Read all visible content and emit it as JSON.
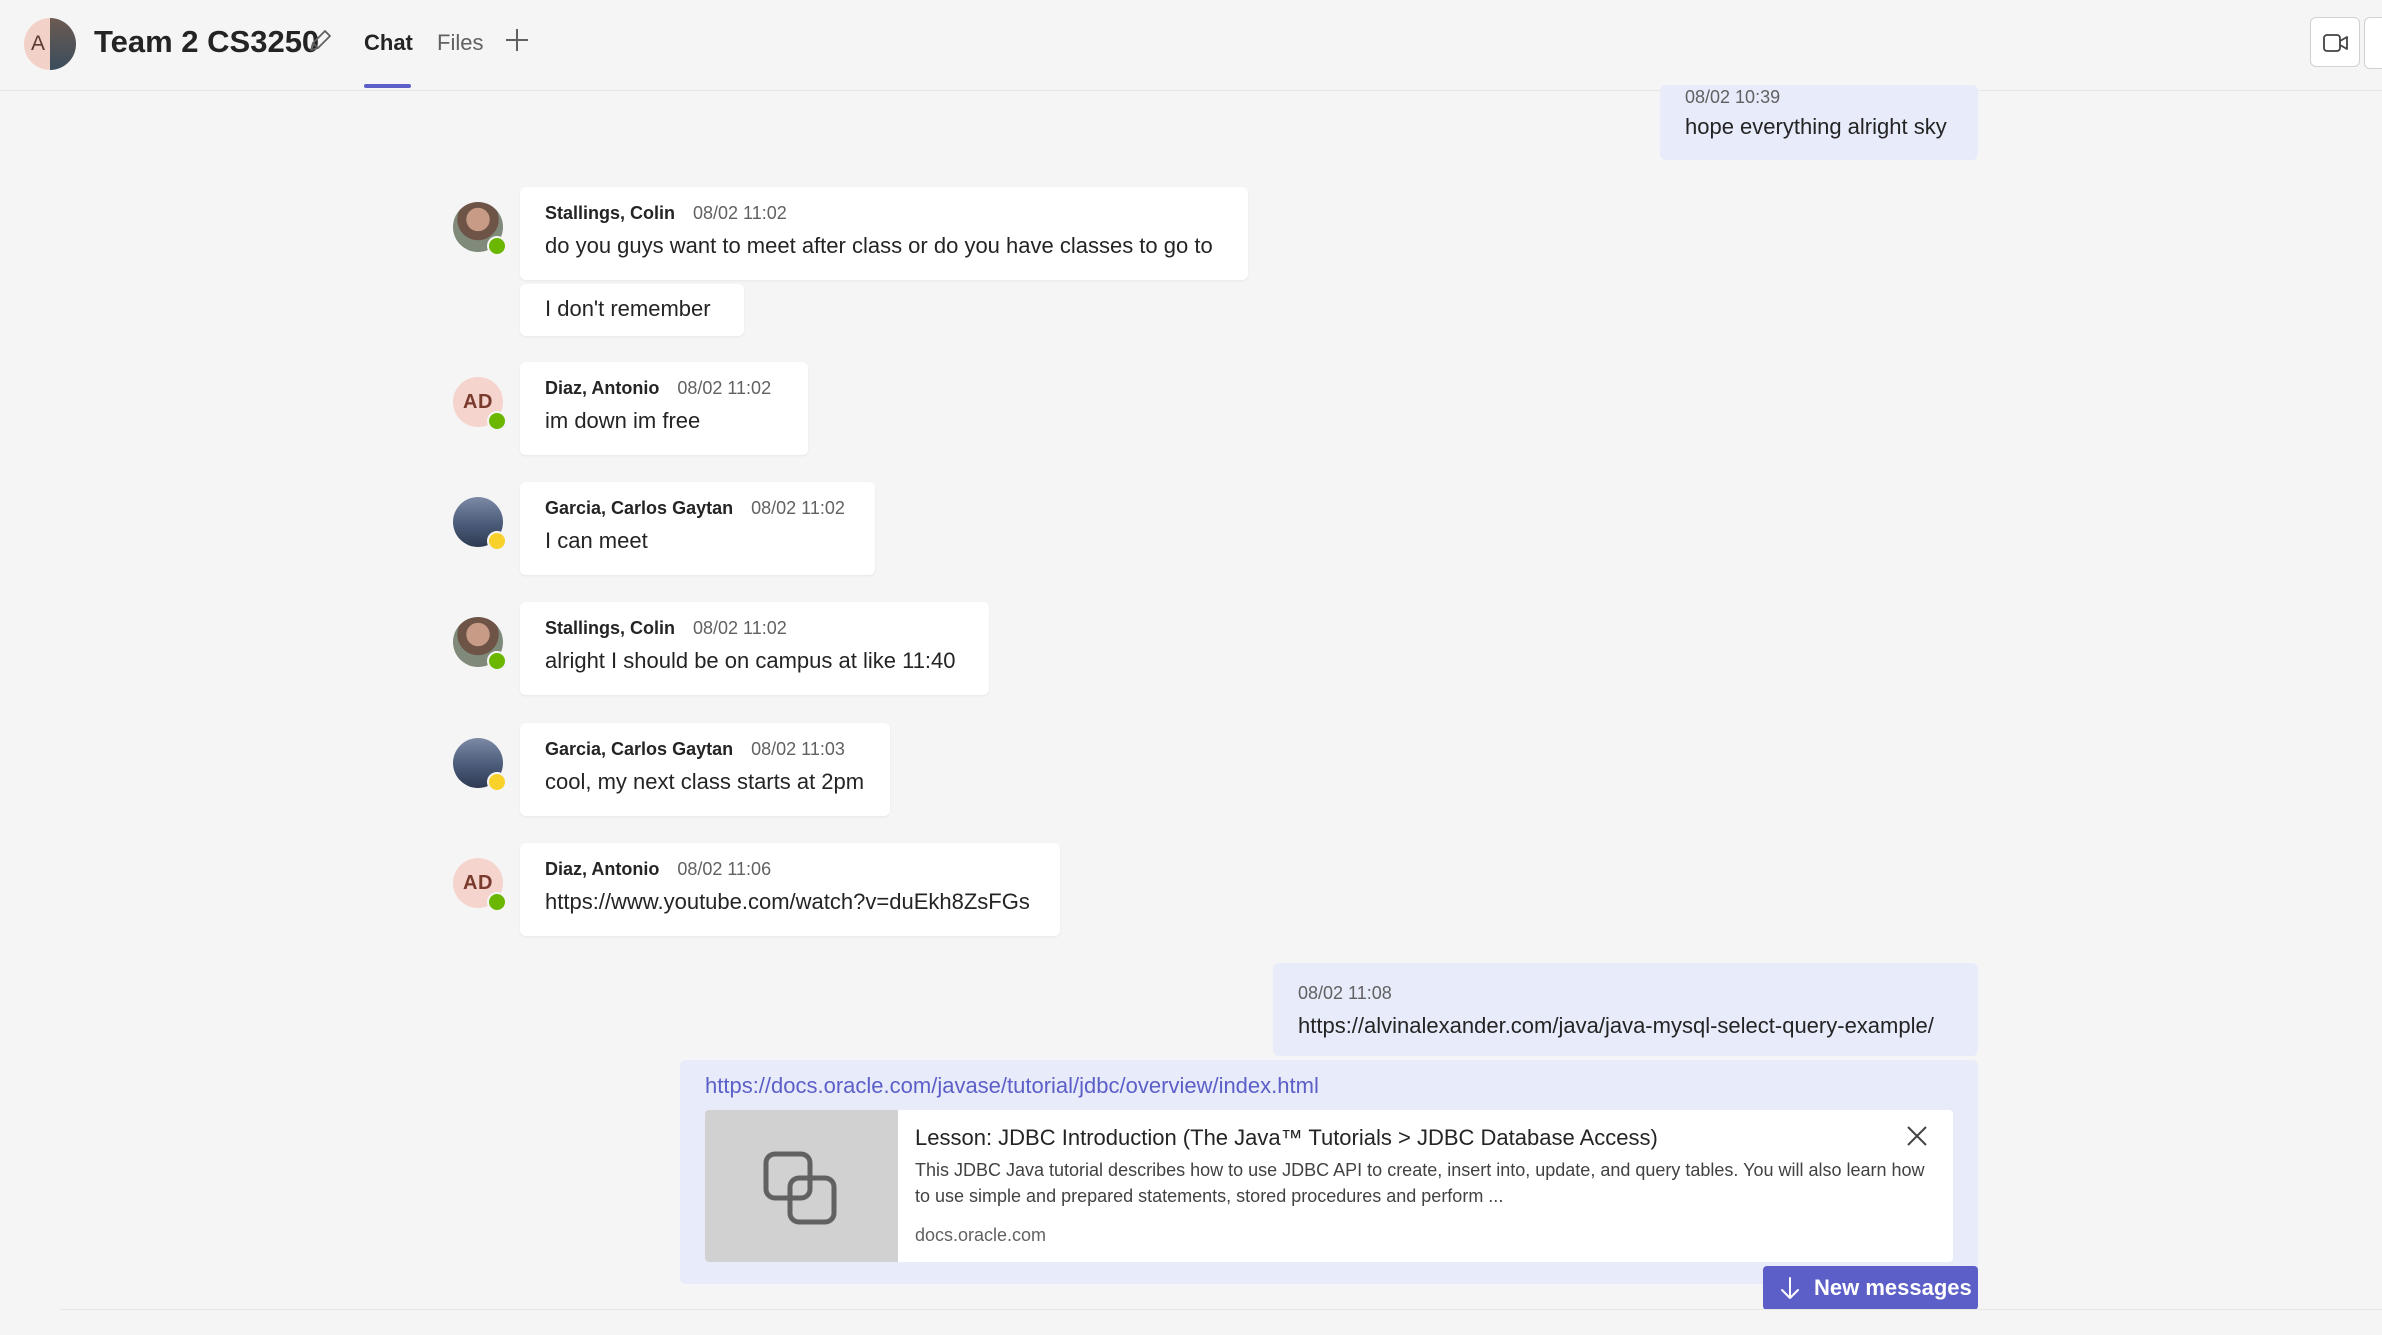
{
  "header": {
    "group_initial": "A",
    "title": "Team 2 CS3250",
    "tabs": [
      {
        "label": "Chat",
        "active": true
      },
      {
        "label": "Files",
        "active": false
      }
    ]
  },
  "messages": [
    {
      "own": true,
      "time": "08/02 10:39",
      "text": "hope everything alright sky"
    },
    {
      "author": "Stallings, Colin",
      "time": "08/02 11:02",
      "text": "do you guys want to meet after class or do you have classes to go to",
      "status": "available"
    },
    {
      "continuation": true,
      "text": "I don't remember"
    },
    {
      "author": "Diaz, Antonio",
      "initials": "AD",
      "time": "08/02 11:02",
      "text": "im down im free",
      "status": "available"
    },
    {
      "author": "Garcia, Carlos Gaytan",
      "time": "08/02 11:02",
      "text": "I can meet",
      "status": "away"
    },
    {
      "author": "Stallings, Colin",
      "time": "08/02 11:02",
      "text": "alright I should be on campus at like 11:40",
      "status": "available"
    },
    {
      "author": "Garcia, Carlos Gaytan",
      "time": "08/02 11:03",
      "text": "cool, my next class starts at 2pm",
      "status": "away"
    },
    {
      "author": "Diaz, Antonio",
      "initials": "AD",
      "time": "08/02 11:06",
      "text": "https://www.youtube.com/watch?v=duEkh8ZsFGs",
      "status": "available",
      "is_link": true
    },
    {
      "own": true,
      "time": "08/02 11:08",
      "text": "https://alvinalexander.com/java/java-mysql-select-query-example/",
      "is_link": true
    }
  ],
  "composer_preview": {
    "url": "https://docs.oracle.com/javase/tutorial/jdbc/overview/index.html",
    "card_title": "Lesson: JDBC Introduction (The Java™ Tutorials > JDBC Database Access)",
    "card_description": "This JDBC Java tutorial describes how to use JDBC API to create, insert into, update, and query tables. You will also learn how to use simple and prepared statements, stored procedures and perform ...",
    "card_domain": "docs.oracle.com",
    "thumb_icon": "link-icon"
  },
  "new_messages_label": "New messages",
  "colors": {
    "accent": "#5b5fc7",
    "own_bubble": "#e8ebfa",
    "available": "#6bb700",
    "away": "#f8d22a"
  }
}
